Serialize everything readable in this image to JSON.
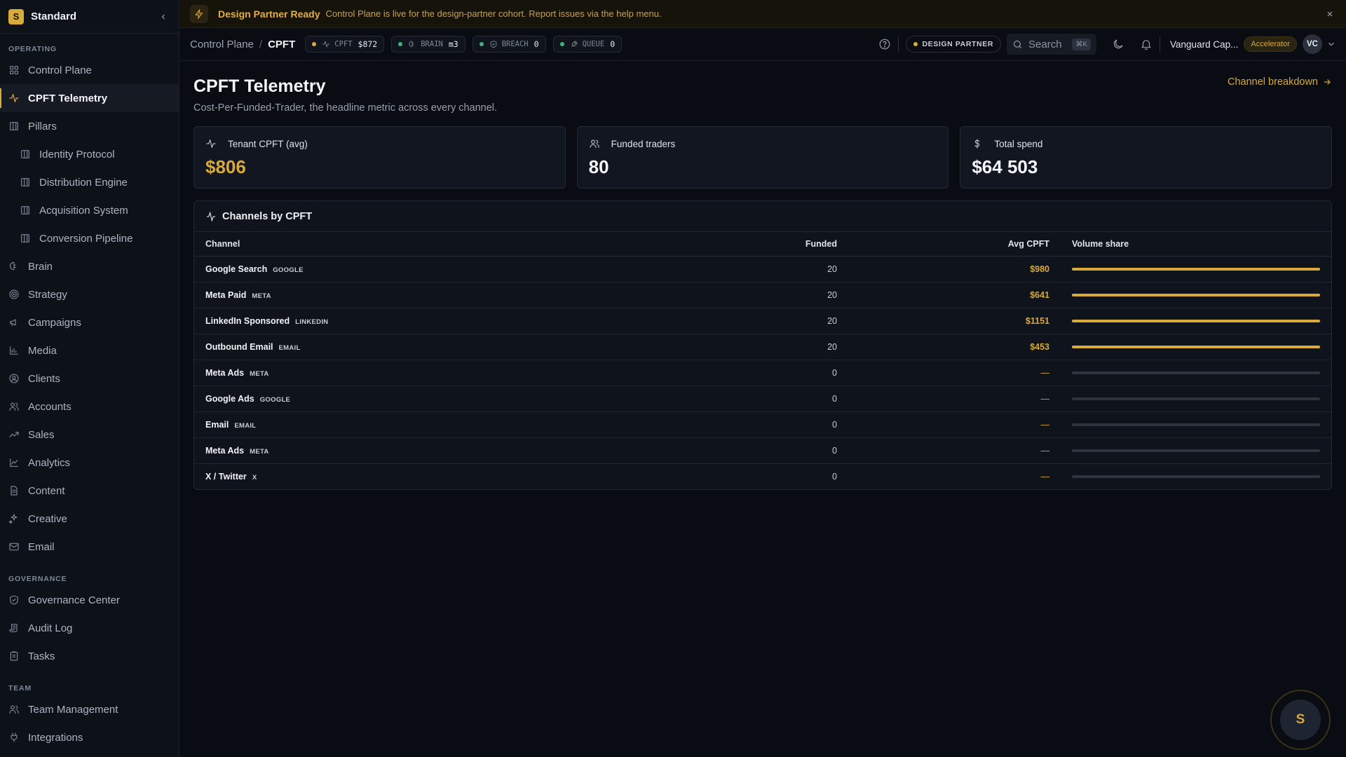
{
  "app": {
    "workspace_initial": "S",
    "workspace_name": "Standard"
  },
  "sidebar": {
    "sections": [
      {
        "title": "OPERATING",
        "items": [
          {
            "label": "Control Plane",
            "icon": "grid-icon"
          },
          {
            "label": "CPFT Telemetry",
            "icon": "activity-icon",
            "active": true
          },
          {
            "label": "Pillars",
            "icon": "columns-icon"
          },
          {
            "label": "Identity Protocol",
            "icon": "columns-icon",
            "sub": true
          },
          {
            "label": "Distribution Engine",
            "icon": "columns-icon",
            "sub": true
          },
          {
            "label": "Acquisition System",
            "icon": "columns-icon",
            "sub": true
          },
          {
            "label": "Conversion Pipeline",
            "icon": "columns-icon",
            "sub": true
          },
          {
            "label": "Brain",
            "icon": "brain-icon"
          },
          {
            "label": "Strategy",
            "icon": "target-icon"
          },
          {
            "label": "Campaigns",
            "icon": "megaphone-icon"
          },
          {
            "label": "Media",
            "icon": "bar-chart-icon"
          },
          {
            "label": "Clients",
            "icon": "user-circle-icon"
          },
          {
            "label": "Accounts",
            "icon": "users-icon"
          },
          {
            "label": "Sales",
            "icon": "trending-up-icon"
          },
          {
            "label": "Analytics",
            "icon": "line-chart-icon"
          },
          {
            "label": "Content",
            "icon": "file-text-icon"
          },
          {
            "label": "Creative",
            "icon": "sparkles-icon"
          },
          {
            "label": "Email",
            "icon": "mail-icon"
          }
        ]
      },
      {
        "title": "GOVERNANCE",
        "items": [
          {
            "label": "Governance Center",
            "icon": "shield-icon"
          },
          {
            "label": "Audit Log",
            "icon": "scroll-icon"
          },
          {
            "label": "Tasks",
            "icon": "clipboard-icon"
          }
        ]
      },
      {
        "title": "TEAM",
        "items": [
          {
            "label": "Team Management",
            "icon": "users-icon"
          },
          {
            "label": "Integrations",
            "icon": "plug-icon"
          }
        ]
      }
    ]
  },
  "banner": {
    "title": "Design Partner Ready",
    "text": "Control Plane is live for the design-partner cohort. Report issues via the help menu."
  },
  "topbar": {
    "crumb_root": "Control Plane",
    "crumb_sep": "/",
    "crumb_current": "CPFT",
    "chips": [
      {
        "label": "CPFT",
        "value": "$872",
        "dot": "#d8a93b",
        "icon": "activity-icon"
      },
      {
        "label": "BRAIN",
        "value": "m3",
        "dot": "#3fb37a",
        "icon": "brain-icon"
      },
      {
        "label": "BREACH",
        "value": "0",
        "dot": "#3fb37a",
        "icon": "shield-icon"
      },
      {
        "label": "QUEUE",
        "value": "0",
        "dot": "#3fb37a",
        "icon": "rocket-icon"
      }
    ],
    "partner_pill": "DESIGN PARTNER",
    "search_placeholder": "Search",
    "search_kbd": "⌘K",
    "org_name": "Vanguard Cap...",
    "plan": "Accelerator",
    "avatar": "VC"
  },
  "page": {
    "title": "CPFT Telemetry",
    "subtitle": "Cost-Per-Funded-Trader, the headline metric across every channel.",
    "link": "Channel breakdown"
  },
  "kpis": [
    {
      "label": "Tenant CPFT (avg)",
      "value": "$806",
      "icon": "activity-icon",
      "gold": true
    },
    {
      "label": "Funded traders",
      "value": "80",
      "icon": "users-icon",
      "gold": false
    },
    {
      "label": "Total spend",
      "value": "$64 503",
      "icon": "dollar-icon",
      "gold": false
    }
  ],
  "table": {
    "title": "Channels by CPFT",
    "columns": [
      "Channel",
      "Funded",
      "Avg CPFT",
      "Volume share"
    ],
    "rows": [
      {
        "name": "Google Search",
        "tag": "GOOGLE",
        "funded": "20",
        "cpft": "$980",
        "share": 1
      },
      {
        "name": "Meta Paid",
        "tag": "META",
        "funded": "20",
        "cpft": "$641",
        "share": 1
      },
      {
        "name": "LinkedIn Sponsored",
        "tag": "LINKEDIN",
        "funded": "20",
        "cpft": "$1151",
        "share": 1
      },
      {
        "name": "Outbound Email",
        "tag": "EMAIL",
        "funded": "20",
        "cpft": "$453",
        "share": 1
      },
      {
        "name": "Meta Ads",
        "tag": "META",
        "funded": "0",
        "cpft": "—",
        "share": 0
      },
      {
        "name": "Google Ads",
        "tag": "GOOGLE",
        "funded": "0",
        "cpft": "—",
        "share": 0
      },
      {
        "name": "Email",
        "tag": "EMAIL",
        "funded": "0",
        "cpft": "—",
        "share": 0
      },
      {
        "name": "Meta Ads",
        "tag": "META",
        "funded": "0",
        "cpft": "—",
        "share": 0
      },
      {
        "name": "X / Twitter",
        "tag": "X",
        "funded": "0",
        "cpft": "—",
        "share": 0
      }
    ]
  },
  "fab": {
    "label": "S"
  },
  "colors": {
    "accent": "#d8a93b",
    "ok": "#3fb37a"
  }
}
